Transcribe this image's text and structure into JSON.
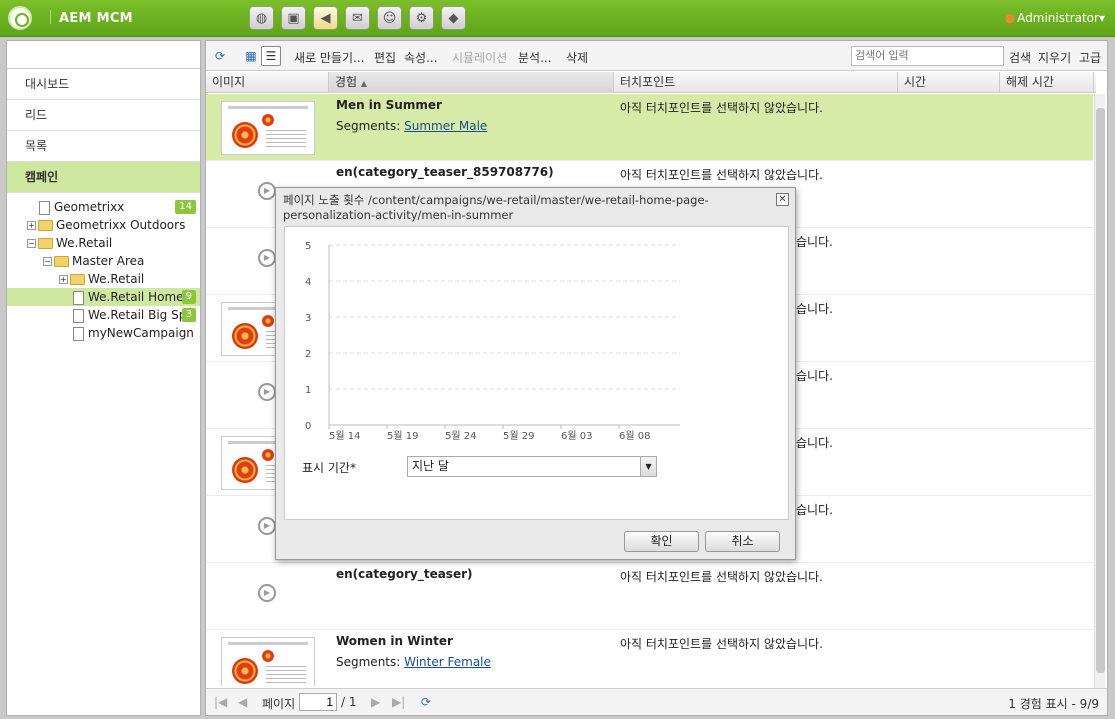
{
  "app": {
    "title": "AEM MCM",
    "user": "Administrator"
  },
  "topnav": [
    "globe-icon",
    "campaign-icon",
    "megaphone-icon",
    "email-icon",
    "users-icon",
    "tools-icon",
    "tag-icon"
  ],
  "sidebar": {
    "items": [
      {
        "label": "대시보드"
      },
      {
        "label": "리드"
      },
      {
        "label": "목록"
      },
      {
        "label": "캠페인"
      }
    ],
    "tree": [
      {
        "label": "Geometrixx",
        "count": "14"
      },
      {
        "label": "Geometrixx Outdoors"
      },
      {
        "label": "We.Retail"
      },
      {
        "label": "Master Area"
      },
      {
        "label": "We.Retail"
      },
      {
        "label": "We.Retail Home",
        "count": "9"
      },
      {
        "label": "We.Retail Big Spe",
        "count": "3"
      },
      {
        "label": "myNewCampaign"
      }
    ]
  },
  "toolbar": {
    "new": "새로 만들기...",
    "edit": "편집",
    "props": "속성...",
    "simulation": "시뮬레이션",
    "analyze": "분석...",
    "delete": "삭제",
    "search_placeholder": "검색어 입력",
    "search": "검색",
    "clear": "지우기",
    "advanced": "고급"
  },
  "columns": [
    "이미지",
    "경험",
    "터치포인트",
    "시간",
    "해제 시간"
  ],
  "rows": [
    {
      "name": "Men in Summer",
      "segments_label": "Segments:",
      "segment": "Summer Male",
      "touchpoint": "아직 터치포인트를 선택하지 않았습니다."
    },
    {
      "name": "en(category_teaser_859708776)",
      "touchpoint": "아직 터치포인트를 선택하지 않았습니다."
    },
    {
      "name": "",
      "touchpoint": "습니다."
    },
    {
      "name": "",
      "touchpoint": "습니다."
    },
    {
      "name": "",
      "touchpoint": "습니다."
    },
    {
      "name": "",
      "touchpoint": "습니다."
    },
    {
      "name": "",
      "touchpoint": "습니다."
    },
    {
      "name": "en(category_teaser)",
      "touchpoint": "아직 터치포인트를 선택하지 않았습니다."
    },
    {
      "name": "Women in Winter",
      "segments_label": "Segments:",
      "segment": "Winter Female",
      "touchpoint": "아직 터치포인트를 선택하지 않았습니다."
    }
  ],
  "footer": {
    "page_label": "페이지",
    "page_value": "1",
    "page_total": "/ 1",
    "status": "1 경험 표시 - 9/9"
  },
  "dialog": {
    "title": "페이지 노출 횟수 /content/campaigns/we-retail/master/we-retail-home-page-personalization-activity/men-in-summer",
    "period_label": "표시 기간*",
    "period_value": "지난 달",
    "ok": "확인",
    "cancel": "취소"
  },
  "chart_data": {
    "type": "line",
    "title": "",
    "xlabel": "",
    "ylabel": "",
    "x": [
      "5월 14",
      "5월 19",
      "5월 24",
      "5월 29",
      "6월 03",
      "6월 08"
    ],
    "y_ticks": [
      0,
      1,
      2,
      3,
      4,
      5
    ],
    "ylim": [
      0,
      5
    ],
    "series": [],
    "grid": true
  }
}
